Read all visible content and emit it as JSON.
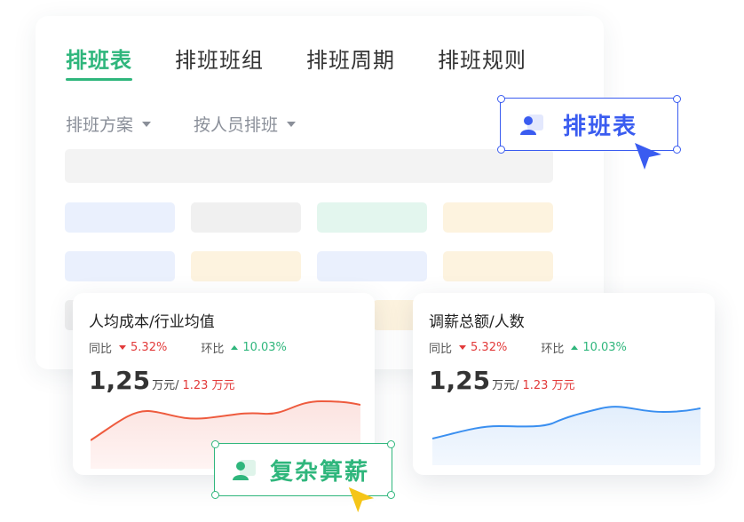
{
  "tabs": [
    "排班表",
    "排班班组",
    "排班周期",
    "排班规则"
  ],
  "filters": [
    "排班方案",
    "按人员排班"
  ],
  "colors": {
    "primary_green": "#2fb67c",
    "accent_blue": "#3a5cf0",
    "up_red": "#e23a3a",
    "cursor_yellow": "#f5c518"
  },
  "kpi_left": {
    "title": "人均成本/行业均值",
    "yoy_label": "同比",
    "yoy_value": "5.32%",
    "mom_label": "环比",
    "mom_value": "10.03%",
    "value": "1,25",
    "unit": "万元/",
    "sub_value": "1.23 万元"
  },
  "kpi_right": {
    "title": "调薪总额/人数",
    "yoy_label": "同比",
    "yoy_value": "5.32%",
    "mom_label": "环比",
    "mom_value": "10.03%",
    "value": "1,25",
    "unit": "万元/",
    "sub_value": "1.23 万元"
  },
  "float_blue": {
    "label": "排班表",
    "icon": "person-icon"
  },
  "float_green": {
    "label": "复杂算薪",
    "icon": "person-icon"
  }
}
